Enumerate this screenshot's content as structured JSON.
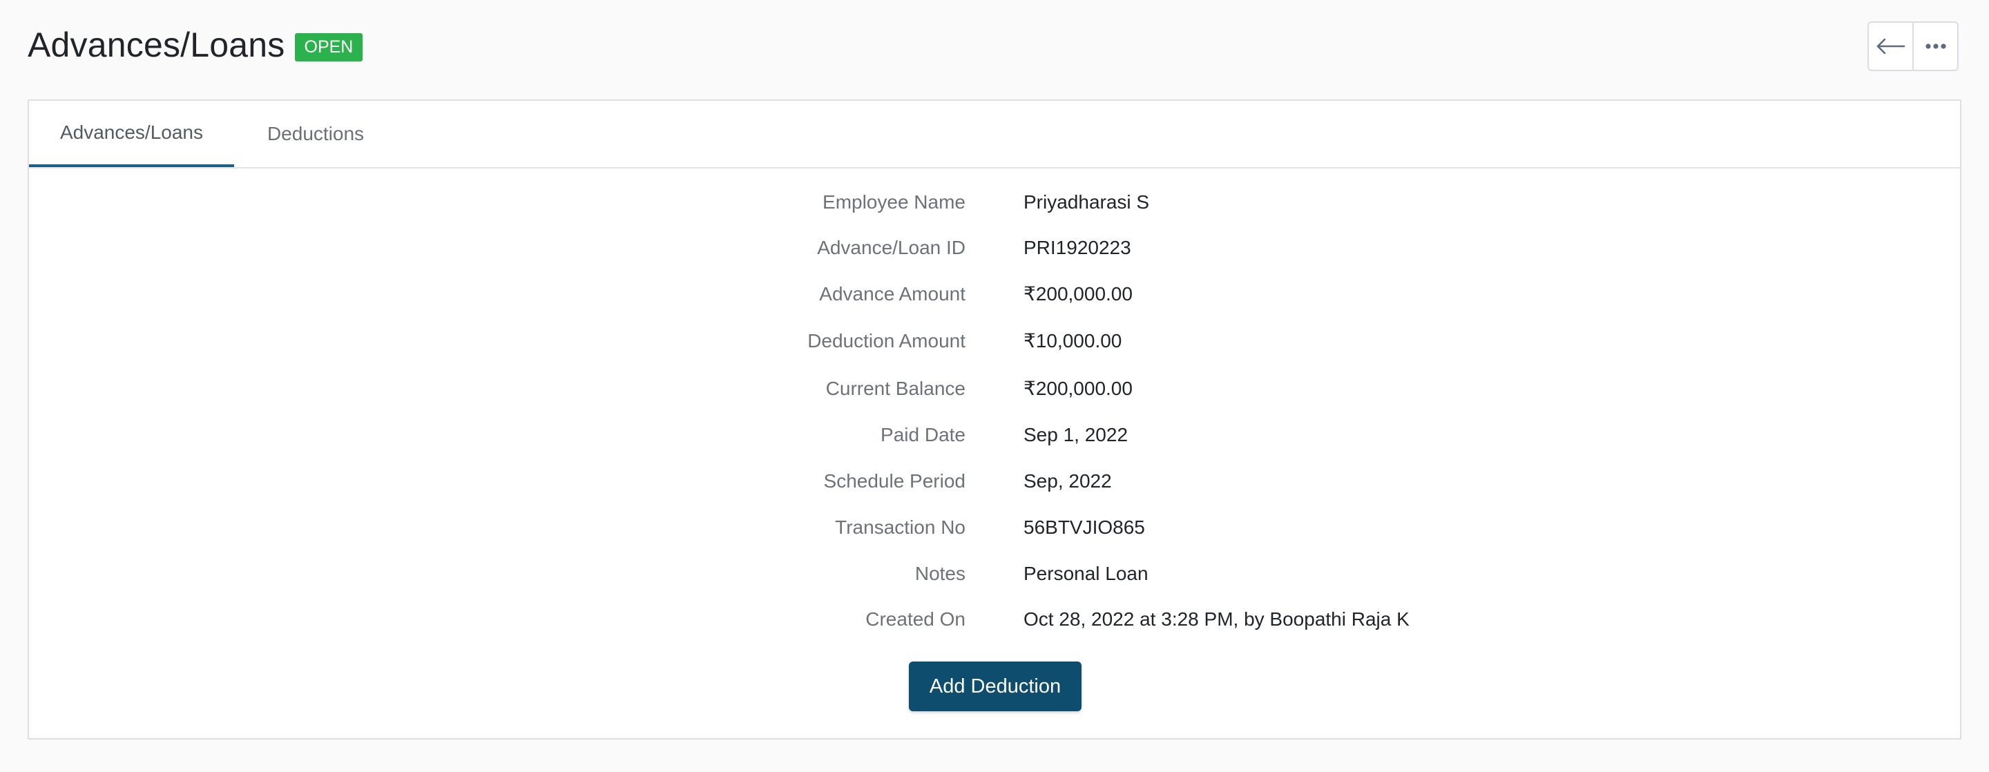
{
  "header": {
    "title": "Advances/Loans",
    "status": "OPEN"
  },
  "toolbar": {
    "back_icon": "arrow-left-icon",
    "more_icon": "more-horizontal-icon"
  },
  "tabs": [
    {
      "label": "Advances/Loans",
      "active": true
    },
    {
      "label": "Deductions",
      "active": false
    }
  ],
  "details": [
    {
      "label": "Employee Name",
      "value": "Priyadharasi S"
    },
    {
      "label": "Advance/Loan ID",
      "value": "PRI1920223"
    },
    {
      "label": "Advance Amount",
      "value": "₹200,000.00"
    },
    {
      "label": "Deduction Amount",
      "value": "₹10,000.00"
    },
    {
      "label": "Current Balance",
      "value": "₹200,000.00"
    },
    {
      "label": "Paid Date",
      "value": "Sep 1, 2022"
    },
    {
      "label": "Schedule Period",
      "value": "Sep, 2022"
    },
    {
      "label": "Transaction No",
      "value": "56BTVJIO865"
    },
    {
      "label": "Notes",
      "value": "Personal Loan"
    },
    {
      "label": "Created On",
      "value": "Oct 28, 2022 at 3:28 PM, by Boopathi Raja K"
    }
  ],
  "actions": {
    "add_deduction_label": "Add Deduction"
  },
  "colors": {
    "accent": "#1b5e86",
    "button": "#0e4d6d",
    "status_open": "#2bb24c"
  }
}
